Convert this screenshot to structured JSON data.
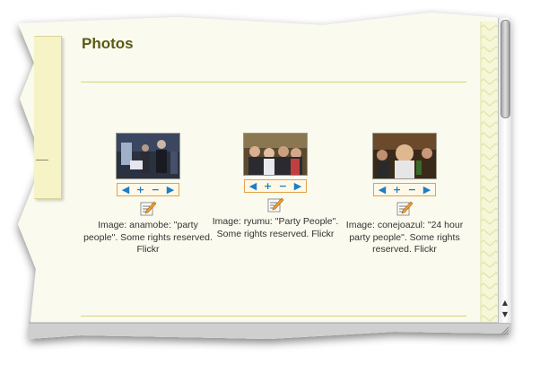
{
  "window": {
    "title": "Photos"
  },
  "photos": [
    {
      "caption": "Image: anamobe: \"party people\". Some rights reserved. Flickr",
      "controls": [
        "◀",
        "+",
        "−",
        "▶"
      ]
    },
    {
      "caption": "Image: ryumu: \"Party People\". Some rights reserved. Flickr",
      "controls": [
        "◀",
        "+",
        "−",
        "▶"
      ]
    },
    {
      "caption": "Image: conejoazul: \"24 hour party people\". Some rights reserved. Flickr",
      "controls": [
        "◀",
        "+",
        "−",
        "▶"
      ]
    }
  ],
  "scrollbar": {
    "up_arrow": "▲",
    "down_arrow": "▼"
  },
  "colors": {
    "background": "#fafaee",
    "title": "#5b5a17",
    "rule": "#d4d57a",
    "control_accent": "#1b7fc6",
    "control_border": "#e0a24d",
    "sidebar": "#f6f3c6",
    "scrollbar_bg": "#eeeeee",
    "status_bar": "#d0d0d0"
  },
  "icons": {
    "edit": "edit-pencil-icon",
    "previous": "triangle-left-icon",
    "zoom_in": "plus-icon",
    "zoom_out": "minus-icon",
    "next": "triangle-right-icon"
  }
}
